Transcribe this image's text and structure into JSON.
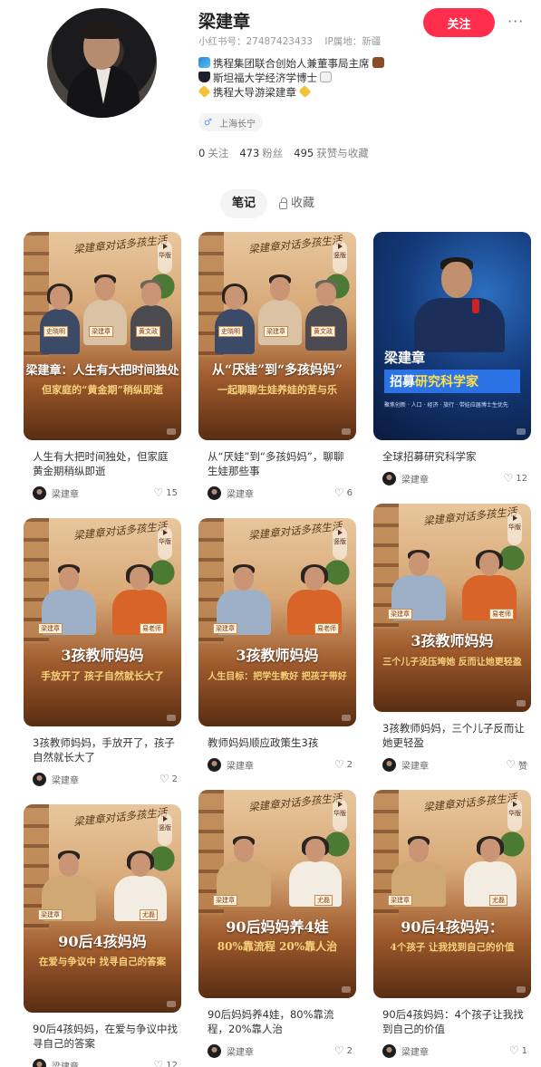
{
  "profile": {
    "name": "梁建章",
    "red_id": "小红书号：27487423433",
    "ip_location": "IP属地：新疆",
    "bio_lines": [
      "携程集团联合创始人兼董事局主席",
      "斯坦福大学经济学博士",
      "携程大导游梁建章"
    ],
    "gender_icon": "male-icon",
    "location_tag": "上海长宁",
    "follow_label": "关注",
    "more_label": "···",
    "stats": {
      "following_count": "0",
      "following_label": "关注",
      "fans_count": "473",
      "fans_label": "粉丝",
      "likes_count": "495",
      "likes_label": "获赞与收藏"
    }
  },
  "tabs": {
    "notes": "笔记",
    "collections": "收藏"
  },
  "covers": {
    "show_title": "梁建章对话多孩生活",
    "badge_hua": "华版",
    "badge_shu": "竖版",
    "name_liang": "梁建章",
    "name_shi": "史晓明",
    "name_huang": "黄文政",
    "name_yi": "易老师",
    "name_you": "尤磊",
    "recruit_name": "梁建章",
    "recruit_prefix": "招募",
    "recruit_highlight": "研究科学家",
    "recruit_small": "聚焦创新 · 人口 · 经济 · 旅行 · 带娃应届博士生优先"
  },
  "notes": [
    {
      "cover_title": "梁建章：人生有大把时间独处",
      "cover_sub": "但家庭的“黄金期”稍纵即逝",
      "caption": "人生有大把时间独处，但家庭黄金期稍纵即逝",
      "author": "梁建章",
      "likes": "15"
    },
    {
      "cover_title": "从“厌娃”到“多孩妈妈”",
      "cover_sub": "一起聊聊生娃养娃的苦与乐",
      "caption": "从“厌娃”到“多孩妈妈”，聊聊生娃那些事",
      "author": "梁建章",
      "likes": "6"
    },
    {
      "cover_title": "",
      "cover_sub": "",
      "caption": "全球招募研究科学家",
      "author": "梁建章",
      "likes": "12"
    },
    {
      "cover_title": "3孩教师妈妈",
      "cover_sub": "手放开了 孩子自然就长大了",
      "caption": "3孩教师妈妈，手放开了，孩子自然就长大了",
      "author": "梁建章",
      "likes": "2"
    },
    {
      "cover_title": "3孩教师妈妈",
      "cover_sub": "人生目标：把学生教好 把孩子带好",
      "caption": "教师妈妈顺应政策生3孩",
      "author": "梁建章",
      "likes": "2"
    },
    {
      "cover_title": "3孩教师妈妈",
      "cover_sub": "三个儿子没压垮她 反而让她更轻盈",
      "caption": "3孩教师妈妈，三个儿子反而让她更轻盈",
      "author": "梁建章",
      "likes": "赞"
    },
    {
      "cover_title": "90后4孩妈妈",
      "cover_sub": "在爱与争议中 找寻自己的答案",
      "caption": "90后4孩妈妈，在爱与争议中找寻自己的答案",
      "author": "梁建章",
      "likes": "12"
    },
    {
      "cover_title": "90后妈妈养4娃",
      "cover_sub": "80%靠流程 20%靠人治",
      "caption": "90后妈妈养4娃，80%靠流程，20%靠人治",
      "author": "梁建章",
      "likes": "2"
    },
    {
      "cover_title": "90后4孩妈妈：",
      "cover_sub": "4个孩子 让我找到自己的价值",
      "caption": "90后4孩妈妈：4个孩子让我找到自己的价值",
      "author": "梁建章",
      "likes": "1"
    }
  ],
  "colors": {
    "accent": "#ff2e4d",
    "recruit_blue": "#2b72e5",
    "cover_sub_gold": "#f8d27a"
  },
  "icons": {
    "heart": "heart-outline-icon",
    "lock": "lock-icon",
    "more": "more-dots-icon"
  }
}
